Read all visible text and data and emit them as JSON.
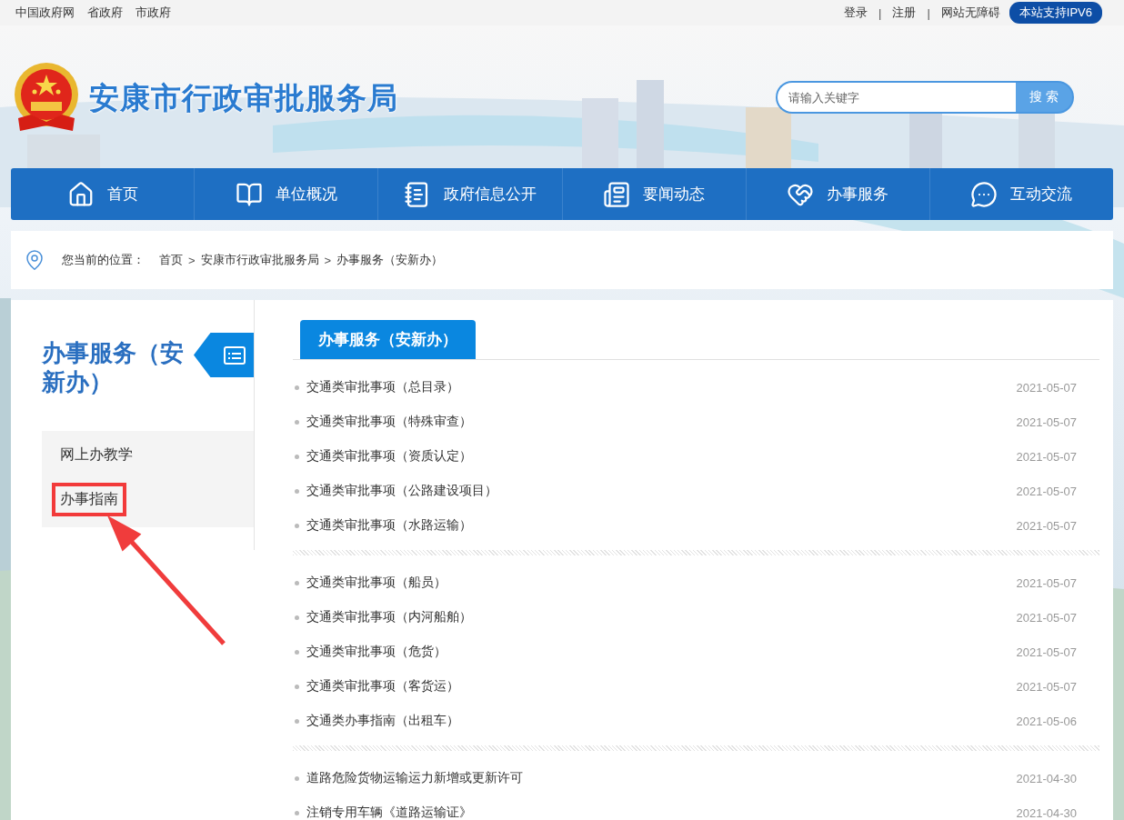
{
  "top_bar": {
    "left_links": [
      "中国政府网",
      "省政府",
      "市政府"
    ],
    "right_links": [
      {
        "kind": "link",
        "text": "登录"
      },
      {
        "kind": "separator",
        "text": "|"
      },
      {
        "kind": "link",
        "text": "注册"
      },
      {
        "kind": "separator",
        "text": "|"
      },
      {
        "kind": "link",
        "text": "网站无障碍"
      }
    ],
    "badge": "本站支持IPV6"
  },
  "header": {
    "title": "安康市行政审批服务局",
    "search": {
      "placeholder": "请输入关键字",
      "button": "搜 索"
    }
  },
  "nav": [
    {
      "label": "首页"
    },
    {
      "label": "单位概况"
    },
    {
      "label": "政府信息公开"
    },
    {
      "label": "要闻动态"
    },
    {
      "label": "办事服务"
    },
    {
      "label": "互动交流"
    }
  ],
  "breadcrumb": {
    "label": "您当前的位置：",
    "items": [
      {
        "kind": "link",
        "text": "首页"
      },
      {
        "kind": "separator",
        "text": ">"
      },
      {
        "kind": "link",
        "text": "安康市行政审批服务局"
      },
      {
        "kind": "separator",
        "text": ">"
      },
      {
        "kind": "link",
        "text": "办事服务（安新办）"
      }
    ]
  },
  "sidebar": {
    "title": "办事服务（安新办）",
    "menu": [
      {
        "label": "网上办教学",
        "highlighted": false
      },
      {
        "label": "办事指南",
        "highlighted": true
      }
    ]
  },
  "callout": {
    "kind": "arrow"
  },
  "content": {
    "tab": "办事服务（安新办）",
    "groups": [
      {
        "items": [
          {
            "title": "交通类审批事项（总目录）",
            "date": "2021-05-07"
          },
          {
            "title": "交通类审批事项（特殊审查）",
            "date": "2021-05-07"
          },
          {
            "title": "交通类审批事项（资质认定）",
            "date": "2021-05-07"
          },
          {
            "title": "交通类审批事项（公路建设项目）",
            "date": "2021-05-07"
          },
          {
            "title": "交通类审批事项（水路运输）",
            "date": "2021-05-07"
          }
        ]
      },
      {
        "items": [
          {
            "title": "交通类审批事项（船员）",
            "date": "2021-05-07"
          },
          {
            "title": "交通类审批事项（内河船舶）",
            "date": "2021-05-07"
          },
          {
            "title": "交通类审批事项（危货）",
            "date": "2021-05-07"
          },
          {
            "title": "交通类审批事项（客货运）",
            "date": "2021-05-07"
          },
          {
            "title": "交通类办事指南（出租车）",
            "date": "2021-05-06"
          }
        ]
      },
      {
        "items": [
          {
            "title": "道路危险货物运输运力新增或更新许可",
            "date": "2021-04-30"
          },
          {
            "title": "注销专用车辆《道路运输证》",
            "date": "2021-04-30"
          }
        ]
      }
    ]
  }
}
